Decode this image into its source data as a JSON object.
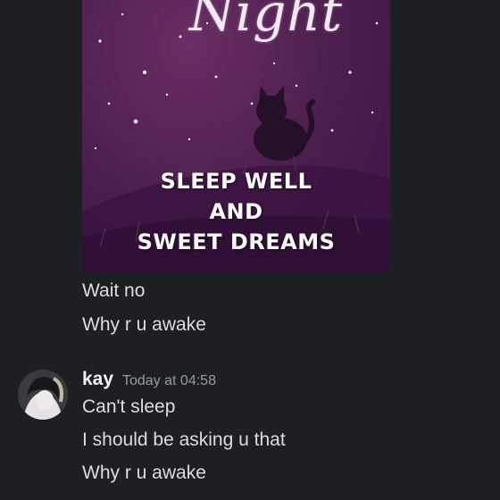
{
  "embed": {
    "script_text": "Night",
    "line1": "SLEEP WELL",
    "line2": "AND",
    "line3": "SWEET DREAMS"
  },
  "messages_before": [
    {
      "text": "Wait no"
    },
    {
      "text": "Why r u awake"
    }
  ],
  "group": {
    "username": "kay",
    "timestamp": "Today at 04:58",
    "messages": [
      {
        "text": "Can't sleep"
      },
      {
        "text": "I should be asking u that"
      },
      {
        "text": "Why r u awake"
      }
    ]
  }
}
